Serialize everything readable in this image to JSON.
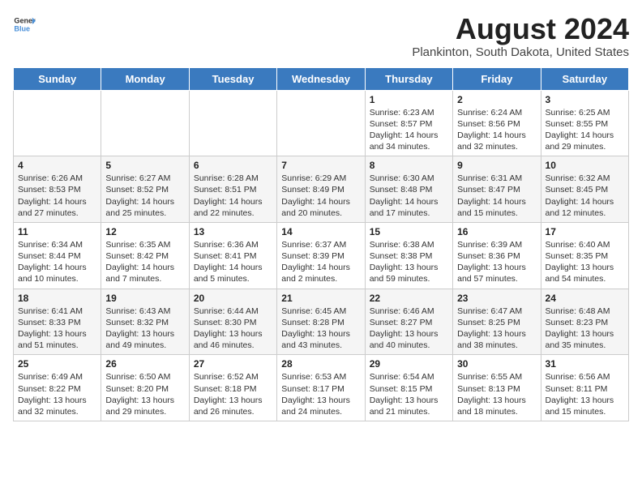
{
  "logo": {
    "line1": "General",
    "line2": "Blue"
  },
  "title": "August 2024",
  "location": "Plankinton, South Dakota, United States",
  "days_of_week": [
    "Sunday",
    "Monday",
    "Tuesday",
    "Wednesday",
    "Thursday",
    "Friday",
    "Saturday"
  ],
  "weeks": [
    [
      {
        "day": "",
        "info": ""
      },
      {
        "day": "",
        "info": ""
      },
      {
        "day": "",
        "info": ""
      },
      {
        "day": "",
        "info": ""
      },
      {
        "day": "1",
        "info": "Sunrise: 6:23 AM\nSunset: 8:57 PM\nDaylight: 14 hours and 34 minutes."
      },
      {
        "day": "2",
        "info": "Sunrise: 6:24 AM\nSunset: 8:56 PM\nDaylight: 14 hours and 32 minutes."
      },
      {
        "day": "3",
        "info": "Sunrise: 6:25 AM\nSunset: 8:55 PM\nDaylight: 14 hours and 29 minutes."
      }
    ],
    [
      {
        "day": "4",
        "info": "Sunrise: 6:26 AM\nSunset: 8:53 PM\nDaylight: 14 hours and 27 minutes."
      },
      {
        "day": "5",
        "info": "Sunrise: 6:27 AM\nSunset: 8:52 PM\nDaylight: 14 hours and 25 minutes."
      },
      {
        "day": "6",
        "info": "Sunrise: 6:28 AM\nSunset: 8:51 PM\nDaylight: 14 hours and 22 minutes."
      },
      {
        "day": "7",
        "info": "Sunrise: 6:29 AM\nSunset: 8:49 PM\nDaylight: 14 hours and 20 minutes."
      },
      {
        "day": "8",
        "info": "Sunrise: 6:30 AM\nSunset: 8:48 PM\nDaylight: 14 hours and 17 minutes."
      },
      {
        "day": "9",
        "info": "Sunrise: 6:31 AM\nSunset: 8:47 PM\nDaylight: 14 hours and 15 minutes."
      },
      {
        "day": "10",
        "info": "Sunrise: 6:32 AM\nSunset: 8:45 PM\nDaylight: 14 hours and 12 minutes."
      }
    ],
    [
      {
        "day": "11",
        "info": "Sunrise: 6:34 AM\nSunset: 8:44 PM\nDaylight: 14 hours and 10 minutes."
      },
      {
        "day": "12",
        "info": "Sunrise: 6:35 AM\nSunset: 8:42 PM\nDaylight: 14 hours and 7 minutes."
      },
      {
        "day": "13",
        "info": "Sunrise: 6:36 AM\nSunset: 8:41 PM\nDaylight: 14 hours and 5 minutes."
      },
      {
        "day": "14",
        "info": "Sunrise: 6:37 AM\nSunset: 8:39 PM\nDaylight: 14 hours and 2 minutes."
      },
      {
        "day": "15",
        "info": "Sunrise: 6:38 AM\nSunset: 8:38 PM\nDaylight: 13 hours and 59 minutes."
      },
      {
        "day": "16",
        "info": "Sunrise: 6:39 AM\nSunset: 8:36 PM\nDaylight: 13 hours and 57 minutes."
      },
      {
        "day": "17",
        "info": "Sunrise: 6:40 AM\nSunset: 8:35 PM\nDaylight: 13 hours and 54 minutes."
      }
    ],
    [
      {
        "day": "18",
        "info": "Sunrise: 6:41 AM\nSunset: 8:33 PM\nDaylight: 13 hours and 51 minutes."
      },
      {
        "day": "19",
        "info": "Sunrise: 6:43 AM\nSunset: 8:32 PM\nDaylight: 13 hours and 49 minutes."
      },
      {
        "day": "20",
        "info": "Sunrise: 6:44 AM\nSunset: 8:30 PM\nDaylight: 13 hours and 46 minutes."
      },
      {
        "day": "21",
        "info": "Sunrise: 6:45 AM\nSunset: 8:28 PM\nDaylight: 13 hours and 43 minutes."
      },
      {
        "day": "22",
        "info": "Sunrise: 6:46 AM\nSunset: 8:27 PM\nDaylight: 13 hours and 40 minutes."
      },
      {
        "day": "23",
        "info": "Sunrise: 6:47 AM\nSunset: 8:25 PM\nDaylight: 13 hours and 38 minutes."
      },
      {
        "day": "24",
        "info": "Sunrise: 6:48 AM\nSunset: 8:23 PM\nDaylight: 13 hours and 35 minutes."
      }
    ],
    [
      {
        "day": "25",
        "info": "Sunrise: 6:49 AM\nSunset: 8:22 PM\nDaylight: 13 hours and 32 minutes."
      },
      {
        "day": "26",
        "info": "Sunrise: 6:50 AM\nSunset: 8:20 PM\nDaylight: 13 hours and 29 minutes."
      },
      {
        "day": "27",
        "info": "Sunrise: 6:52 AM\nSunset: 8:18 PM\nDaylight: 13 hours and 26 minutes."
      },
      {
        "day": "28",
        "info": "Sunrise: 6:53 AM\nSunset: 8:17 PM\nDaylight: 13 hours and 24 minutes."
      },
      {
        "day": "29",
        "info": "Sunrise: 6:54 AM\nSunset: 8:15 PM\nDaylight: 13 hours and 21 minutes."
      },
      {
        "day": "30",
        "info": "Sunrise: 6:55 AM\nSunset: 8:13 PM\nDaylight: 13 hours and 18 minutes."
      },
      {
        "day": "31",
        "info": "Sunrise: 6:56 AM\nSunset: 8:11 PM\nDaylight: 13 hours and 15 minutes."
      }
    ]
  ]
}
